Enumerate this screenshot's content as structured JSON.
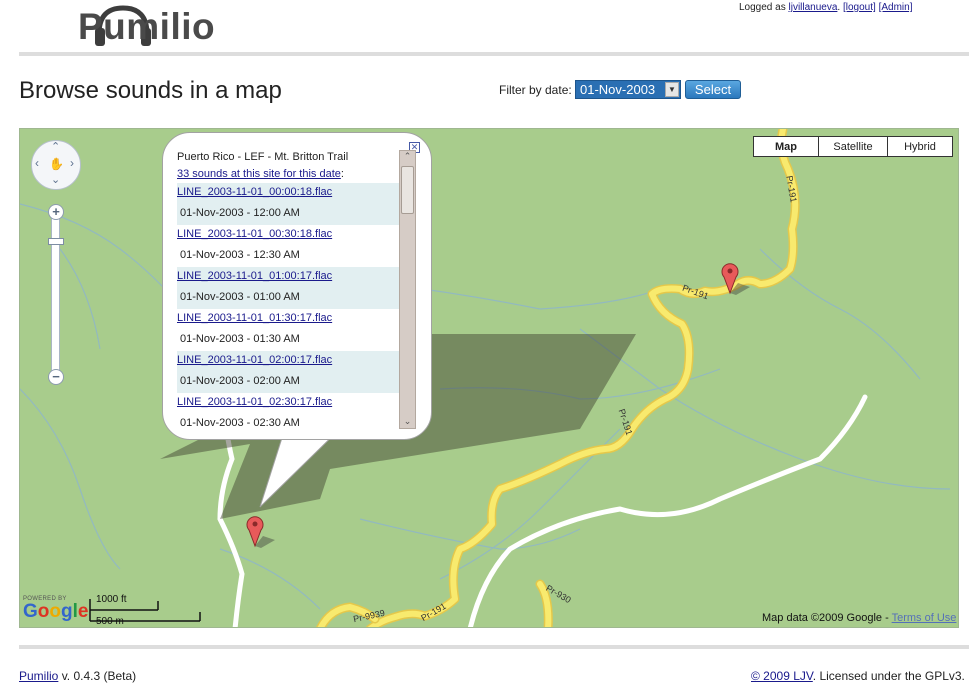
{
  "header": {
    "app_name": "Pumilio",
    "user_bar": {
      "prefix": "Logged as ",
      "username": "ljvillanueva",
      "logout": "[logout]",
      "admin": "[Admin]"
    }
  },
  "page": {
    "title": "Browse sounds in a map"
  },
  "filter": {
    "label": "Filter by date:",
    "selected_date": "01-Nov-2003",
    "button": "Select"
  },
  "map": {
    "map_types": [
      "Map",
      "Satellite",
      "Hybrid"
    ],
    "active_map_type": "Map",
    "road_labels": [
      "Pr-191",
      "Pr-191",
      "Pr-191",
      "Pr-191",
      "Pr-930",
      "Pr-9939"
    ],
    "attribution": {
      "powered_by": "POWERED BY",
      "logo": "Google",
      "scale_imperial": "1000 ft",
      "scale_metric": "500 m",
      "map_data": "Map data ©2009 Google - ",
      "terms": "Terms of Use"
    },
    "info_window": {
      "site": "Puerto Rico - LEF - Mt. Britton Trail",
      "count_link": "33 sounds at this site for this date",
      "count_suffix": ":",
      "files": [
        {
          "name": "LINE_2003-11-01_00:00:18.flac",
          "time": "01-Nov-2003 - 12:00 AM"
        },
        {
          "name": "LINE_2003-11-01_00:30:18.flac",
          "time": "01-Nov-2003 - 12:30 AM"
        },
        {
          "name": "LINE_2003-11-01_01:00:17.flac",
          "time": "01-Nov-2003 - 01:00 AM"
        },
        {
          "name": "LINE_2003-11-01_01:30:17.flac",
          "time": "01-Nov-2003 - 01:30 AM"
        },
        {
          "name": "LINE_2003-11-01_02:00:17.flac",
          "time": "01-Nov-2003 - 02:00 AM"
        },
        {
          "name": "LINE_2003-11-01_02:30:17.flac",
          "time": "01-Nov-2003 - 02:30 AM"
        }
      ]
    },
    "colors": {
      "land": "#a8cc8c",
      "road": "#f8ea6e",
      "road_edge": "#e5c84a",
      "secondary_road": "#ffffff",
      "marker": "#e85a5a"
    }
  },
  "footer": {
    "app_link": "Pumilio",
    "version": " v. 0.4.3 (Beta)",
    "copyright_link": "© 2009 LJV",
    "license": ". Licensed under the GPLv3."
  }
}
